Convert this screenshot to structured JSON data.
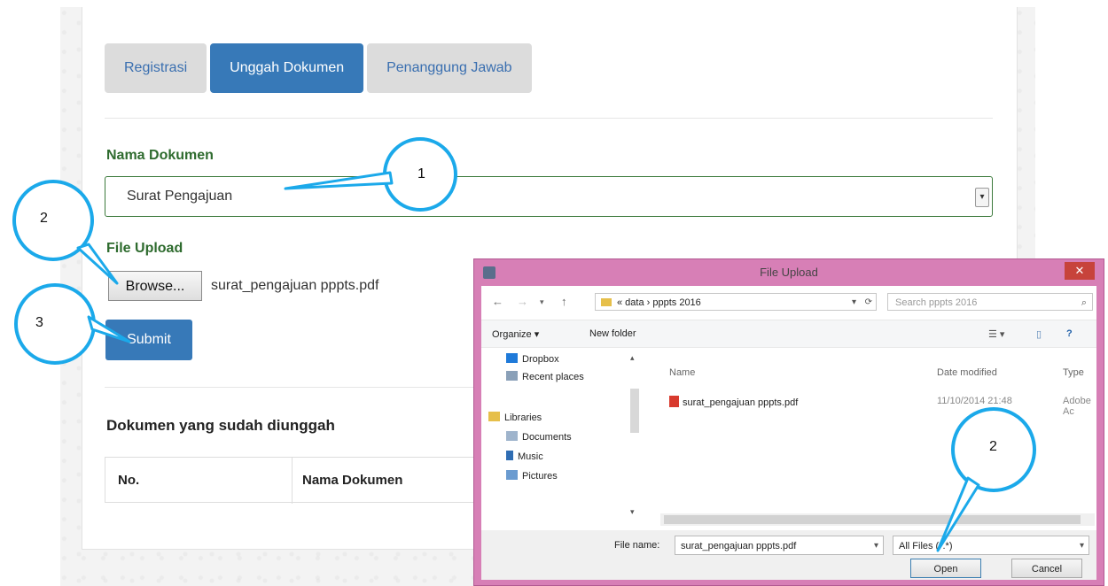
{
  "tabs": [
    {
      "label": "Registrasi",
      "active": false
    },
    {
      "label": "Unggah Dokumen",
      "active": true
    },
    {
      "label": "Penanggung Jawab",
      "active": false
    }
  ],
  "form": {
    "doc_name_label": "Nama Dokumen",
    "doc_name_value": "Surat Pengajuan",
    "file_upload_label": "File Upload",
    "browse_label": "Browse...",
    "chosen_file": "surat_pengajuan pppts.pdf",
    "submit_label": "Submit"
  },
  "uploaded": {
    "heading": "Dokumen yang sudah diunggah",
    "columns": [
      "No.",
      "Nama Dokumen"
    ]
  },
  "dialog": {
    "title": "File Upload",
    "close_glyph": "✕",
    "back_glyph": "←",
    "forward_glyph": "→",
    "up_glyph": "↑",
    "breadcrumb": "« data › pppts 2016",
    "refresh_glyph": "⟳",
    "search_placeholder": "Search pppts 2016",
    "organize_label": "Organize ▾",
    "new_folder_label": "New folder",
    "tree": [
      {
        "label": "Dropbox",
        "icon": "dropbox-icon",
        "color": "#1f7ad9"
      },
      {
        "label": "Recent places",
        "icon": "recent-places-icon",
        "color": "#8aa0b8"
      },
      {
        "label": "Libraries",
        "icon": "libraries-icon",
        "color": "#e6bf4a"
      },
      {
        "label": "Documents",
        "icon": "documents-icon",
        "color": "#9fb4cc"
      },
      {
        "label": "Music",
        "icon": "music-icon",
        "color": "#2f6db3"
      },
      {
        "label": "Pictures",
        "icon": "pictures-icon",
        "color": "#6a9bd0"
      }
    ],
    "columns": {
      "name": "Name",
      "date": "Date modified",
      "type": "Type"
    },
    "files": [
      {
        "name": "surat_pengajuan pppts.pdf",
        "date": "11/10/2014 21:48",
        "type": "Adobe Ac"
      }
    ],
    "file_name_label": "File name:",
    "file_name_value": "surat_pengajuan pppts.pdf",
    "filter_value": "All Files (*.*)",
    "open_label": "Open",
    "cancel_label": "Cancel"
  },
  "callouts": {
    "one": "1",
    "two_left": "2",
    "three": "3",
    "two_dialog": "2",
    "color": "#1ba9ea"
  }
}
